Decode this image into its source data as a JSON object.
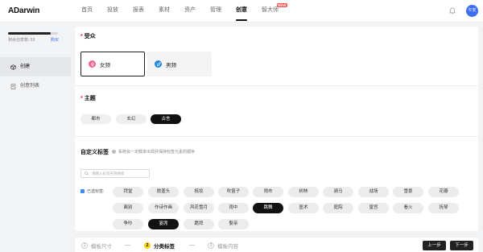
{
  "app": {
    "logo_prefix": "A",
    "logo_rest": "Darwin"
  },
  "nav": [
    {
      "label": "首页"
    },
    {
      "label": "投放"
    },
    {
      "label": "报表"
    },
    {
      "label": "素材"
    },
    {
      "label": "资产"
    },
    {
      "label": "管理"
    },
    {
      "label": "创意",
      "active": true
    },
    {
      "label": "智大师",
      "badge": "NEW"
    }
  ],
  "user": {
    "avatar_text": "午安"
  },
  "sidebar": {
    "quota_label": "剩余创意数: 53",
    "quota_fraction": 0.85,
    "quota_link": "购买",
    "items": [
      {
        "label": "创建",
        "icon": "cube-icon",
        "active": true
      },
      {
        "label": "创意列表",
        "icon": "list-icon"
      }
    ]
  },
  "audience": {
    "title": "受众",
    "options": [
      {
        "label": "女频",
        "color": "#f06292",
        "selected": true
      },
      {
        "label": "男频",
        "color": "#1e88e5",
        "selected": false
      }
    ]
  },
  "theme": {
    "title": "主题",
    "options": [
      {
        "label": "都市",
        "selected": false
      },
      {
        "label": "玄幻",
        "selected": false
      },
      {
        "label": "古言",
        "selected": true
      }
    ]
  },
  "custom_tags": {
    "title": "自定义标签",
    "hint": "系统会一定概率出现并保持标签元素的顺序",
    "search_placeholder": "请输入标签名称搜索",
    "selected_label": "已选标签:",
    "tags": [
      {
        "label": "拜堂"
      },
      {
        "label": "掀盖头"
      },
      {
        "label": "梳妆"
      },
      {
        "label": "吹笛子"
      },
      {
        "label": "闹市"
      },
      {
        "label": "树林"
      },
      {
        "label": "骑马"
      },
      {
        "label": "战场"
      },
      {
        "label": "雪景"
      },
      {
        "label": "花瓣"
      },
      {
        "label": "离别"
      },
      {
        "label": "作诗作画"
      },
      {
        "label": "风花雪月"
      },
      {
        "label": "雨中"
      },
      {
        "label": "跳舞",
        "selected": true
      },
      {
        "label": "医术"
      },
      {
        "label": "庭院"
      },
      {
        "label": "皇宫"
      },
      {
        "label": "看火"
      },
      {
        "label": "抚琴"
      },
      {
        "label": "争吵"
      },
      {
        "label": "宴席",
        "selected": true
      },
      {
        "label": "跪拜"
      },
      {
        "label": "娶亲"
      }
    ]
  },
  "steps": [
    {
      "num": "1",
      "label": "模板尺寸"
    },
    {
      "num": "2",
      "label": "分类标签",
      "active": true
    },
    {
      "num": "3",
      "label": "模板内容"
    }
  ],
  "buttons": {
    "prev": "上一步",
    "next": "下一步"
  }
}
